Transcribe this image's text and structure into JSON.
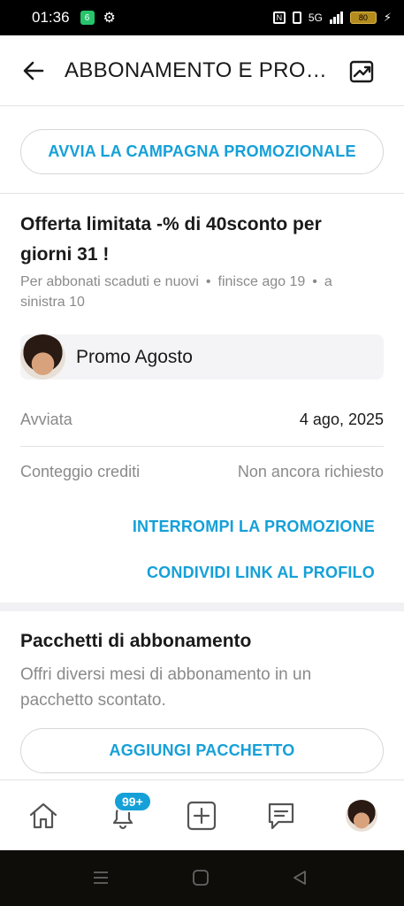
{
  "status_bar": {
    "time": "01:36",
    "app_badge": "6",
    "network": "5G",
    "battery": "80"
  },
  "header": {
    "title": "ABBONAMENTO E PRO…"
  },
  "campaign": {
    "start_button": "AVVIA LA CAMPAGNA PROMOZIONALE"
  },
  "offer": {
    "title": "Offerta limitata -% di 40sconto per giorni 31 !",
    "audience": "Per abbonati scaduti e nuovi",
    "ends": "finisce ago 19",
    "remaining": "a sinistra 10",
    "separator": "•",
    "promo_name": "Promo Agosto",
    "started_label": "Avviata",
    "started_value": "4 ago, 2025",
    "credits_label": "Conteggio crediti",
    "credits_value": "Non ancora richiesto",
    "stop_button": "INTERROMPI LA PROMOZIONE",
    "share_button": "CONDIVIDI LINK AL PROFILO"
  },
  "bundles": {
    "title": "Pacchetti di abbonamento",
    "description": "Offri diversi mesi di abbonamento in un pacchetto scontato.",
    "add_button": "AGGIUNGI PACCHETTO"
  },
  "bottom_nav": {
    "notifications_badge": "99+",
    "items": [
      "home-icon",
      "bell-icon",
      "plus-square-icon",
      "chat-icon",
      "avatar"
    ]
  },
  "colors": {
    "accent": "#15a0d8",
    "muted_text": "#8a8a8a",
    "divider": "#e3e3e3"
  }
}
